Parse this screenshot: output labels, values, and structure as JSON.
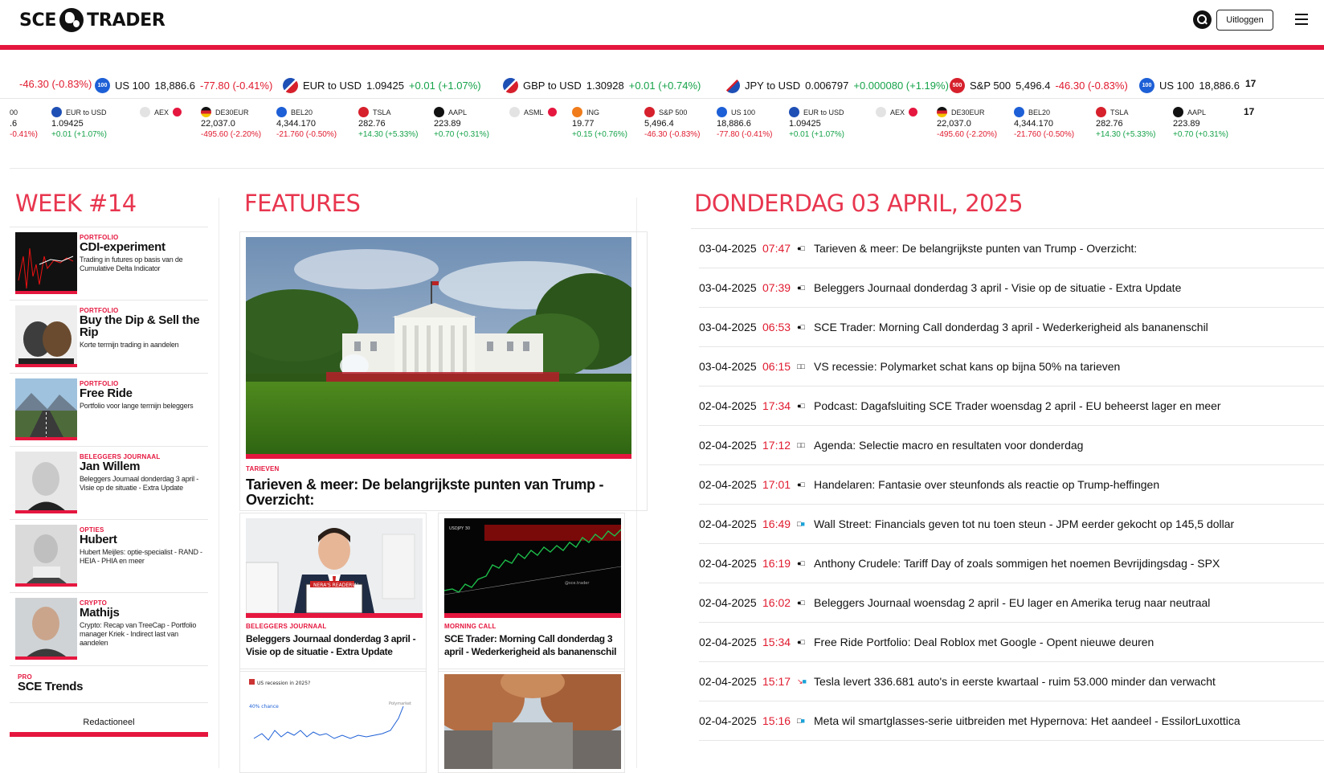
{
  "brand": {
    "name_left": "SCE",
    "name_right": "TRADER"
  },
  "header": {
    "logout_label": "Uitloggen"
  },
  "ticker_top": [
    {
      "icon": "",
      "sym": "",
      "px": "",
      "chg": "-46.30 (-0.83%)",
      "dir": "neg"
    },
    {
      "icon": "100",
      "sym": "US 100",
      "px": "18,886.6",
      "chg": "-77.80 (-0.41%)",
      "dir": "neg"
    },
    {
      "icon": "",
      "sym": "EUR to USD",
      "px": "1.09425",
      "chg": "+0.01 (+1.07%)",
      "dir": "pos"
    },
    {
      "icon": "",
      "sym": "GBP to USD",
      "px": "1.30928",
      "chg": "+0.01 (+0.74%)",
      "dir": "pos"
    },
    {
      "icon": "",
      "sym": "JPY to USD",
      "px": "0.006797",
      "chg": "+0.000080 (+1.19%)",
      "dir": "pos"
    },
    {
      "icon": "500",
      "sym": "S&P 500",
      "px": "5,496.4",
      "chg": "-46.30 (-0.83%)",
      "dir": "neg"
    },
    {
      "icon": "100",
      "sym": "US 100",
      "px": "18,886.6",
      "chg": "",
      "dir": "neg"
    }
  ],
  "ticker_bottom": [
    {
      "name": "00",
      "val": ".6",
      "chg": "-0.41%)",
      "dir": "neg"
    },
    {
      "name": "EUR to USD",
      "val": "1.09425",
      "chg": "+0.01 (+1.07%)",
      "dir": "pos"
    },
    {
      "name": "AEX",
      "val": "",
      "chg": "",
      "dir": "neg"
    },
    {
      "name": "DE30EUR",
      "val": "22,037.0",
      "chg": "-495.60 (-2.20%)",
      "dir": "neg"
    },
    {
      "name": "BEL20",
      "val": "4,344.170",
      "chg": "-21.760 (-0.50%)",
      "dir": "neg"
    },
    {
      "name": "TSLA",
      "val": "282.76",
      "chg": "+14.30 (+5.33%)",
      "dir": "pos"
    },
    {
      "name": "AAPL",
      "val": "223.89",
      "chg": "+0.70 (+0.31%)",
      "dir": "pos"
    },
    {
      "name": "ASML",
      "val": "",
      "chg": "",
      "dir": "neg"
    },
    {
      "name": "ING",
      "val": "19.77",
      "chg": "+0.15 (+0.76%)",
      "dir": "pos"
    },
    {
      "name": "S&P 500",
      "val": "5,496.4",
      "chg": "-46.30 (-0.83%)",
      "dir": "neg"
    },
    {
      "name": "US 100",
      "val": "18,886.6",
      "chg": "-77.80 (-0.41%)",
      "dir": "neg"
    },
    {
      "name": "EUR to USD",
      "val": "1.09425",
      "chg": "+0.01 (+1.07%)",
      "dir": "pos"
    },
    {
      "name": "AEX",
      "val": "",
      "chg": "",
      "dir": "neg"
    },
    {
      "name": "DE30EUR",
      "val": "22,037.0",
      "chg": "-495.60 (-2.20%)",
      "dir": "neg"
    },
    {
      "name": "BEL20",
      "val": "4,344.170",
      "chg": "-21.760 (-0.50%)",
      "dir": "neg"
    },
    {
      "name": "TSLA",
      "val": "282.76",
      "chg": "+14.30 (+5.33%)",
      "dir": "pos"
    },
    {
      "name": "AAPL",
      "val": "223.89",
      "chg": "+0.70 (+0.31%)",
      "dir": "pos"
    }
  ],
  "week": {
    "heading": "WEEK #14",
    "cards": [
      {
        "cat": "PORTFOLIO",
        "title": "CDI-experiment",
        "sub": "Trading in futures op basis van de Cumulative Delta Indicator"
      },
      {
        "cat": "PORTFOLIO",
        "title": "Buy the Dip & Sell the Rip",
        "sub": "Korte termijn trading in aandelen"
      },
      {
        "cat": "PORTFOLIO",
        "title": "Free Ride",
        "sub": "Portfolio voor lange termijn beleggers"
      },
      {
        "cat": "BELEGGERS JOURNAAL",
        "title": "Jan Willem",
        "sub": "Beleggers Journaal donderdag 3 april - Visie op de situatie - Extra Update"
      },
      {
        "cat": "OPTIES",
        "title": "Hubert",
        "sub": "Hubert Meijles: optie-specialist - RAND - HEIA - PHIA en meer"
      },
      {
        "cat": "CRYPTO",
        "title": "Mathijs",
        "sub": "Crypto: Recap van TreeCap - Portfolio manager Kriek - Indirect last van aandelen"
      }
    ],
    "pro_cat": "PRO",
    "pro_title": "SCE Trends",
    "tab": "Redactioneel"
  },
  "features": {
    "heading": "FEATURES",
    "main": {
      "cat": "TARIEVEN",
      "title": "Tarieven & meer: De belangrijkste punten van Trump - Overzicht:"
    },
    "left": {
      "cat": "BELEGGERS JOURNAAL",
      "title": "Beleggers Journaal donderdag 3 april - Visie op de situatie - Extra Update"
    },
    "right": {
      "cat": "MORNING CALL",
      "title": "SCE Trader: Morning Call donderdag 3 april - Wederkerigheid als bananenschil"
    },
    "chart_caption": "US recession in 2025?",
    "chart_chance": "40% chance"
  },
  "newsfeed": {
    "heading": "DONDERDAG 03 APRIL, 2025",
    "items": [
      {
        "date": "03-04-2025",
        "time": "07:47",
        "mark": "●□",
        "title": "Tarieven & meer: De belangrijkste punten van Trump - Overzicht:"
      },
      {
        "date": "03-04-2025",
        "time": "07:39",
        "mark": "●□",
        "title": "Beleggers Journaal donderdag 3 april - Visie op de situatie - Extra Update"
      },
      {
        "date": "03-04-2025",
        "time": "06:53",
        "mark": "●□",
        "title": "SCE Trader: Morning Call donderdag 3 april - Wederkerigheid als bananenschil"
      },
      {
        "date": "03-04-2025",
        "time": "06:15",
        "mark": "□□",
        "title": "VS recessie: Polymarket schat kans op bijna 50% na tarieven"
      },
      {
        "date": "02-04-2025",
        "time": "17:34",
        "mark": "●□",
        "title": "Podcast: Dagafsluiting SCE Trader woensdag 2 april - EU beheerst lager en meer"
      },
      {
        "date": "02-04-2025",
        "time": "17:12",
        "mark": "□□",
        "title": "Agenda: Selectie macro en resultaten voor donderdag"
      },
      {
        "date": "02-04-2025",
        "time": "17:01",
        "mark": "●□",
        "title": "Handelaren: Fantasie over steunfonds als reactie op Trump-heffingen"
      },
      {
        "date": "02-04-2025",
        "time": "16:49",
        "mark": "□■",
        "title": "Wall Street: Financials geven tot nu toen steun - JPM eerder gekocht op 145,5 dollar"
      },
      {
        "date": "02-04-2025",
        "time": "16:19",
        "mark": "●□",
        "title": "Anthony Crudele: Tariff Day of zoals sommigen het noemen Bevrijdingsdag - SPX"
      },
      {
        "date": "02-04-2025",
        "time": "16:02",
        "mark": "●□",
        "title": "Beleggers Journaal woensdag 2 april - EU lager en Amerika terug naar neutraal"
      },
      {
        "date": "02-04-2025",
        "time": "15:34",
        "mark": "●□",
        "title": "Free Ride Portfolio: Deal Roblox met Google - Opent nieuwe deuren"
      },
      {
        "date": "02-04-2025",
        "time": "15:17",
        "mark": "↘■",
        "title": "Tesla levert 336.681 auto's in eerste kwartaal - ruim 53.000 minder dan verwacht"
      },
      {
        "date": "02-04-2025",
        "time": "15:16",
        "mark": "□■",
        "title": "Meta wil smartglasses-serie uitbreiden met Hypernova: Het aandeel - EssilorLuxottica"
      }
    ]
  },
  "colors": {
    "accent": "#e5173f",
    "heading": "#e8364f",
    "neg": "#e01b2f",
    "pos": "#16a34a"
  }
}
